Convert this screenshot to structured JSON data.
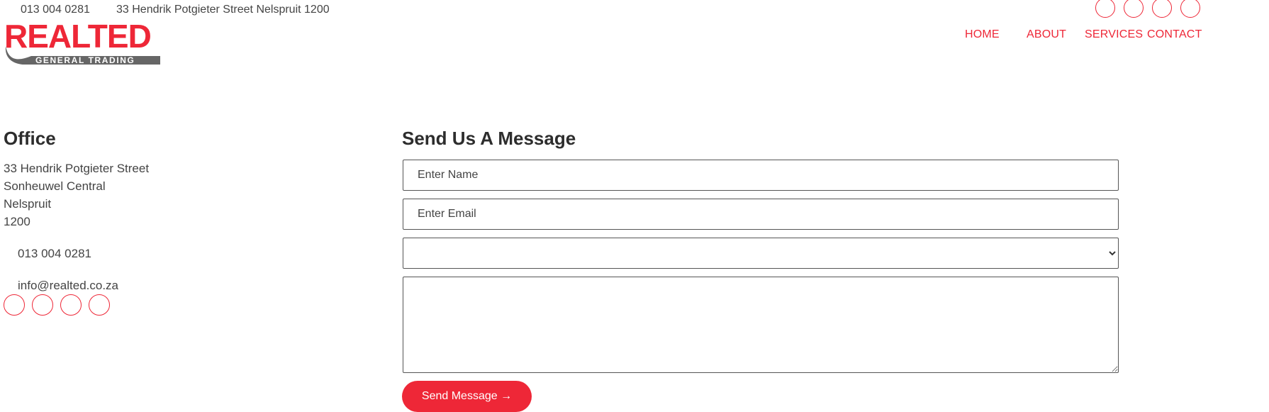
{
  "topbar": {
    "phone": "013 004 0281",
    "address": "33 Hendrik Potgieter Street Nelspruit 1200",
    "social_icons": [
      "social-icon-1",
      "social-icon-2",
      "social-icon-3",
      "social-icon-4"
    ]
  },
  "logo": {
    "main_text": "REALTED",
    "sub_text": "GENERAL TRADING",
    "brand_color": "#ee2737",
    "secondary_color": "#666666"
  },
  "nav": {
    "items": [
      "HOME",
      "ABOUT",
      "SERVICES",
      "CONTACT"
    ]
  },
  "office": {
    "title": "Office",
    "address_lines": [
      "33 Hendrik Potgieter Street",
      "Sonheuwel Central",
      "Nelspruit",
      "1200"
    ],
    "phone": "013 004 0281",
    "email": "info@realted.co.za",
    "social_icons": [
      "social-icon-1",
      "social-icon-2",
      "social-icon-3",
      "social-icon-4"
    ]
  },
  "form": {
    "title": "Send Us A Message",
    "name_placeholder": "Enter Name",
    "email_placeholder": "Enter Email",
    "select_value": "",
    "message_value": "",
    "submit_label": "Send Message →"
  },
  "colors": {
    "accent": "#ee2737",
    "heading": "#2d2d2d",
    "text": "#444444"
  }
}
